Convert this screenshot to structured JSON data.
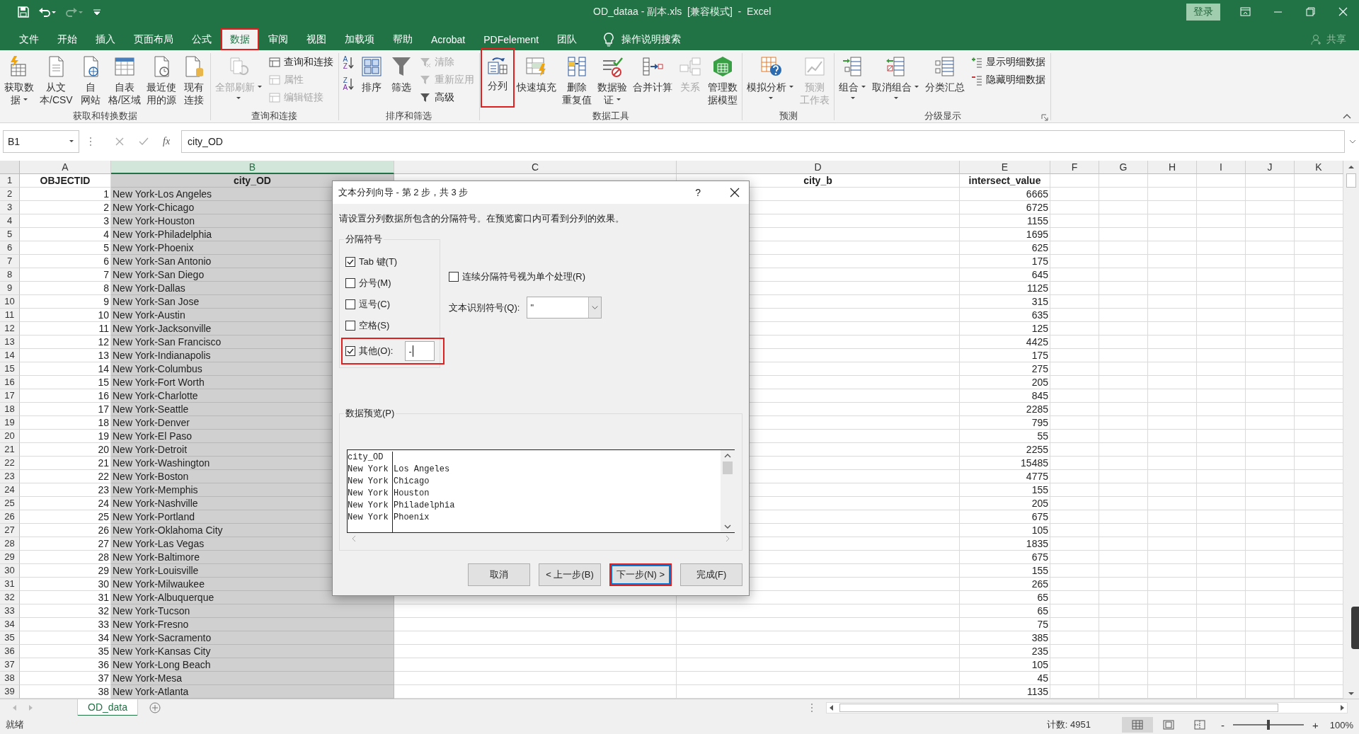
{
  "title_bar": {
    "title": "OD_dataa - 副本.xls  [兼容模式]  -  Excel",
    "sign_in": "登录"
  },
  "tabs": [
    {
      "label": "文件",
      "selected": false,
      "highlighted": false
    },
    {
      "label": "开始",
      "selected": false,
      "highlighted": false
    },
    {
      "label": "插入",
      "selected": false,
      "highlighted": false
    },
    {
      "label": "页面布局",
      "selected": false,
      "highlighted": false
    },
    {
      "label": "公式",
      "selected": false,
      "highlighted": false
    },
    {
      "label": "数据",
      "selected": true,
      "highlighted": true
    },
    {
      "label": "审阅",
      "selected": false,
      "highlighted": false
    },
    {
      "label": "视图",
      "selected": false,
      "highlighted": false
    },
    {
      "label": "加载项",
      "selected": false,
      "highlighted": false
    },
    {
      "label": "帮助",
      "selected": false,
      "highlighted": false
    },
    {
      "label": "Acrobat",
      "selected": false,
      "highlighted": false
    },
    {
      "label": "PDFelement",
      "selected": false,
      "highlighted": false
    },
    {
      "label": "团队",
      "selected": false,
      "highlighted": false
    }
  ],
  "tell_me": "操作说明搜索",
  "share": "共享",
  "ribbon": {
    "groups": [
      {
        "label": "获取和转换数据",
        "launcher": false,
        "items": [
          {
            "kind": "large",
            "lines": [
              "获取数",
              "据"
            ],
            "dropdown": true,
            "disabled": false,
            "highlighted": false
          },
          {
            "kind": "large",
            "lines": [
              "从文",
              "本/CSV"
            ],
            "dropdown": false,
            "disabled": false,
            "highlighted": false
          },
          {
            "kind": "large",
            "lines": [
              "自",
              "网站"
            ],
            "dropdown": false,
            "disabled": false,
            "highlighted": false
          },
          {
            "kind": "large",
            "lines": [
              "自表",
              "格/区域"
            ],
            "dropdown": false,
            "disabled": false,
            "highlighted": false
          },
          {
            "kind": "large",
            "lines": [
              "最近使",
              "用的源"
            ],
            "dropdown": false,
            "disabled": false,
            "highlighted": false
          },
          {
            "kind": "large",
            "lines": [
              "现有",
              "连接"
            ],
            "dropdown": false,
            "disabled": false,
            "highlighted": false
          }
        ]
      },
      {
        "label": "查询和连接",
        "launcher": false,
        "items": [
          {
            "kind": "large",
            "lines": [
              "全部刷新"
            ],
            "dropdown": true,
            "disabled": true,
            "highlighted": false
          },
          {
            "kind": "stack",
            "items": [
              {
                "label": "查询和连接",
                "disabled": false
              },
              {
                "label": "属性",
                "disabled": true
              },
              {
                "label": "编辑链接",
                "disabled": true
              }
            ]
          }
        ]
      },
      {
        "label": "排序和筛选",
        "launcher": false,
        "items": [
          {
            "kind": "sort-stack",
            "items": [
              {
                "letters": [
                  "A",
                  "Z"
                ]
              },
              {
                "letters": [
                  "Z",
                  "A"
                ]
              }
            ]
          },
          {
            "kind": "large",
            "lines": [
              "排序"
            ],
            "dropdown": false,
            "disabled": false,
            "highlighted": false
          },
          {
            "kind": "large",
            "lines": [
              "筛选"
            ],
            "dropdown": false,
            "disabled": false,
            "highlighted": false
          },
          {
            "kind": "stack",
            "items": [
              {
                "label": "清除",
                "disabled": true
              },
              {
                "label": "重新应用",
                "disabled": true
              },
              {
                "label": "高级",
                "disabled": false
              }
            ]
          }
        ]
      },
      {
        "label": "数据工具",
        "launcher": false,
        "items": [
          {
            "kind": "large",
            "lines": [
              "分列"
            ],
            "dropdown": false,
            "disabled": false,
            "highlighted": true
          },
          {
            "kind": "large",
            "lines": [
              "快速填充"
            ],
            "dropdown": false,
            "disabled": false,
            "highlighted": false
          },
          {
            "kind": "large",
            "lines": [
              "删除",
              "重复值"
            ],
            "dropdown": false,
            "disabled": false,
            "highlighted": false
          },
          {
            "kind": "large",
            "lines": [
              "数据验",
              "证"
            ],
            "dropdown": true,
            "disabled": false,
            "highlighted": false
          },
          {
            "kind": "large",
            "lines": [
              "合并计算"
            ],
            "dropdown": false,
            "disabled": false,
            "highlighted": false
          },
          {
            "kind": "large",
            "lines": [
              "关系"
            ],
            "dropdown": false,
            "disabled": true,
            "highlighted": false
          },
          {
            "kind": "large",
            "lines": [
              "管理数",
              "据模型"
            ],
            "dropdown": false,
            "disabled": false,
            "highlighted": false
          }
        ]
      },
      {
        "label": "预测",
        "launcher": false,
        "items": [
          {
            "kind": "large",
            "lines": [
              "模拟分析"
            ],
            "dropdown": true,
            "disabled": false,
            "highlighted": false
          },
          {
            "kind": "large",
            "lines": [
              "预测",
              "工作表"
            ],
            "dropdown": false,
            "disabled": true,
            "highlighted": false
          }
        ]
      },
      {
        "label": "分级显示",
        "launcher": true,
        "items": [
          {
            "kind": "large",
            "lines": [
              "组合"
            ],
            "dropdown": true,
            "disabled": false,
            "highlighted": false
          },
          {
            "kind": "large",
            "lines": [
              "取消组合"
            ],
            "dropdown": true,
            "disabled": false,
            "highlighted": false
          },
          {
            "kind": "large",
            "lines": [
              "分类汇总"
            ],
            "dropdown": false,
            "disabled": false,
            "highlighted": false
          },
          {
            "kind": "stack",
            "items": [
              {
                "label": "显示明细数据",
                "disabled": false
              },
              {
                "label": "隐藏明细数据",
                "disabled": false
              }
            ]
          }
        ]
      }
    ]
  },
  "formula_bar": {
    "name_box": "B1",
    "function_label": "fx",
    "value": "city_OD"
  },
  "columns": [
    {
      "letter": "A",
      "selected": false
    },
    {
      "letter": "B",
      "selected": true
    },
    {
      "letter": "C",
      "selected": false
    },
    {
      "letter": "D",
      "selected": false
    },
    {
      "letter": "E",
      "selected": false
    },
    {
      "letter": "F",
      "selected": false
    },
    {
      "letter": "G",
      "selected": false
    },
    {
      "letter": "H",
      "selected": false
    },
    {
      "letter": "I",
      "selected": false
    },
    {
      "letter": "J",
      "selected": false
    },
    {
      "letter": "K",
      "selected": false
    }
  ],
  "rows": [
    {
      "number": "1",
      "kind": "header",
      "cells": {
        "A": "OBJECTID",
        "B": "city_OD",
        "D": "city_b",
        "E": "intersect_value"
      }
    },
    {
      "number": "2",
      "kind": "data",
      "cells": {
        "A": "1",
        "B": "New York-Los Angeles",
        "E": "6665"
      }
    },
    {
      "number": "3",
      "kind": "data",
      "cells": {
        "A": "2",
        "B": "New York-Chicago",
        "E": "6725"
      }
    },
    {
      "number": "4",
      "kind": "data",
      "cells": {
        "A": "3",
        "B": "New York-Houston",
        "E": "1155"
      }
    },
    {
      "number": "5",
      "kind": "data",
      "cells": {
        "A": "4",
        "B": "New York-Philadelphia",
        "E": "1695"
      }
    },
    {
      "number": "6",
      "kind": "data",
      "cells": {
        "A": "5",
        "B": "New York-Phoenix",
        "E": "625"
      }
    },
    {
      "number": "7",
      "kind": "data",
      "cells": {
        "A": "6",
        "B": "New York-San Antonio",
        "E": "175"
      }
    },
    {
      "number": "8",
      "kind": "data",
      "cells": {
        "A": "7",
        "B": "New York-San Diego",
        "E": "645"
      }
    },
    {
      "number": "9",
      "kind": "data",
      "cells": {
        "A": "8",
        "B": "New York-Dallas",
        "E": "1125"
      }
    },
    {
      "number": "10",
      "kind": "data",
      "cells": {
        "A": "9",
        "B": "New York-San Jose",
        "E": "315"
      }
    },
    {
      "number": "11",
      "kind": "data",
      "cells": {
        "A": "10",
        "B": "New York-Austin",
        "E": "635"
      }
    },
    {
      "number": "12",
      "kind": "data",
      "cells": {
        "A": "11",
        "B": "New York-Jacksonville",
        "E": "125"
      }
    },
    {
      "number": "13",
      "kind": "data",
      "cells": {
        "A": "12",
        "B": "New York-San Francisco",
        "E": "4425"
      }
    },
    {
      "number": "14",
      "kind": "data",
      "cells": {
        "A": "13",
        "B": "New York-Indianapolis",
        "E": "175"
      }
    },
    {
      "number": "15",
      "kind": "data",
      "cells": {
        "A": "14",
        "B": "New York-Columbus",
        "E": "275"
      }
    },
    {
      "number": "16",
      "kind": "data",
      "cells": {
        "A": "15",
        "B": "New York-Fort Worth",
        "E": "205"
      }
    },
    {
      "number": "17",
      "kind": "data",
      "cells": {
        "A": "16",
        "B": "New York-Charlotte",
        "E": "845"
      }
    },
    {
      "number": "18",
      "kind": "data",
      "cells": {
        "A": "17",
        "B": "New York-Seattle",
        "E": "2285"
      }
    },
    {
      "number": "19",
      "kind": "data",
      "cells": {
        "A": "18",
        "B": "New York-Denver",
        "E": "795"
      }
    },
    {
      "number": "20",
      "kind": "data",
      "cells": {
        "A": "19",
        "B": "New York-El Paso",
        "E": "55"
      }
    },
    {
      "number": "21",
      "kind": "data",
      "cells": {
        "A": "20",
        "B": "New York-Detroit",
        "E": "2255"
      }
    },
    {
      "number": "22",
      "kind": "data",
      "cells": {
        "A": "21",
        "B": "New York-Washington",
        "E": "15485"
      }
    },
    {
      "number": "23",
      "kind": "data",
      "cells": {
        "A": "22",
        "B": "New York-Boston",
        "E": "4775"
      }
    },
    {
      "number": "24",
      "kind": "data",
      "cells": {
        "A": "23",
        "B": "New York-Memphis",
        "E": "155"
      }
    },
    {
      "number": "25",
      "kind": "data",
      "cells": {
        "A": "24",
        "B": "New York-Nashville",
        "E": "205"
      }
    },
    {
      "number": "26",
      "kind": "data",
      "cells": {
        "A": "25",
        "B": "New York-Portland",
        "E": "675"
      }
    },
    {
      "number": "27",
      "kind": "data",
      "cells": {
        "A": "26",
        "B": "New York-Oklahoma City",
        "E": "105"
      }
    },
    {
      "number": "28",
      "kind": "data",
      "cells": {
        "A": "27",
        "B": "New York-Las Vegas",
        "E": "1835"
      }
    },
    {
      "number": "29",
      "kind": "data",
      "cells": {
        "A": "28",
        "B": "New York-Baltimore",
        "E": "675"
      }
    },
    {
      "number": "30",
      "kind": "data",
      "cells": {
        "A": "29",
        "B": "New York-Louisville",
        "E": "155"
      }
    },
    {
      "number": "31",
      "kind": "data",
      "cells": {
        "A": "30",
        "B": "New York-Milwaukee",
        "E": "265"
      }
    },
    {
      "number": "32",
      "kind": "data",
      "cells": {
        "A": "31",
        "B": "New York-Albuquerque",
        "E": "65"
      }
    },
    {
      "number": "33",
      "kind": "data",
      "cells": {
        "A": "32",
        "B": "New York-Tucson",
        "E": "65"
      }
    },
    {
      "number": "34",
      "kind": "data",
      "cells": {
        "A": "33",
        "B": "New York-Fresno",
        "E": "75"
      }
    },
    {
      "number": "35",
      "kind": "data",
      "cells": {
        "A": "34",
        "B": "New York-Sacramento",
        "E": "385"
      }
    },
    {
      "number": "36",
      "kind": "data",
      "cells": {
        "A": "35",
        "B": "New York-Kansas City",
        "E": "235"
      }
    },
    {
      "number": "37",
      "kind": "data",
      "cells": {
        "A": "36",
        "B": "New York-Long Beach",
        "E": "105"
      }
    },
    {
      "number": "38",
      "kind": "data",
      "cells": {
        "A": "37",
        "B": "New York-Mesa",
        "E": "45"
      }
    },
    {
      "number": "39",
      "kind": "data",
      "cells": {
        "A": "38",
        "B": "New York-Atlanta",
        "E": "1135"
      }
    }
  ],
  "sheets": [
    {
      "label": "OD_data",
      "selected": true
    }
  ],
  "status_bar": {
    "ready": "就绪",
    "count": "计数: 4951",
    "views": [
      {
        "kind": "normal",
        "selected": true
      },
      {
        "kind": "page-layout",
        "selected": false
      },
      {
        "kind": "page-break",
        "selected": false
      }
    ],
    "zoom_out": "-",
    "zoom_slider": {
      "level": 0.5
    },
    "zoom_in": "+",
    "zoom": "100%"
  },
  "dialog": {
    "title": "文本分列向导 - 第 2 步，共 3 步",
    "help": "?",
    "instruction": "请设置分列数据所包含的分隔符号。在预览窗口内可看到分列的效果。",
    "delimiters": {
      "label": "分隔符号",
      "options": [
        {
          "label": "Tab 键(T)",
          "checked": true,
          "highlighted": false
        },
        {
          "label": "分号(M)",
          "checked": false,
          "highlighted": false
        },
        {
          "label": "逗号(C)",
          "checked": false,
          "highlighted": false
        },
        {
          "label": "空格(S)",
          "checked": false,
          "highlighted": false
        },
        {
          "label": "其他(O):",
          "checked": true,
          "highlighted": true,
          "value": "-"
        }
      ]
    },
    "consecutive": {
      "label": "连续分隔符号视为单个处理(R)",
      "checked": false
    },
    "qualifier": {
      "label": "文本识别符号(Q):",
      "value": "\""
    },
    "preview": {
      "label": "数据预览(P)",
      "rows": [
        [
          "city_OD"
        ],
        [
          "New York",
          "Los Angeles"
        ],
        [
          "New York",
          "Chicago"
        ],
        [
          "New York",
          "Houston"
        ],
        [
          "New York",
          "Philadelphia"
        ],
        [
          "New York",
          "Phoenix"
        ]
      ]
    },
    "buttons": [
      {
        "label": "取消",
        "default": false,
        "highlighted": false
      },
      {
        "label": "< 上一步(B)",
        "default": false,
        "highlighted": false
      },
      {
        "label": "下一步(N) >",
        "default": true,
        "highlighted": true
      },
      {
        "label": "完成(F)",
        "default": false,
        "highlighted": false
      }
    ]
  }
}
